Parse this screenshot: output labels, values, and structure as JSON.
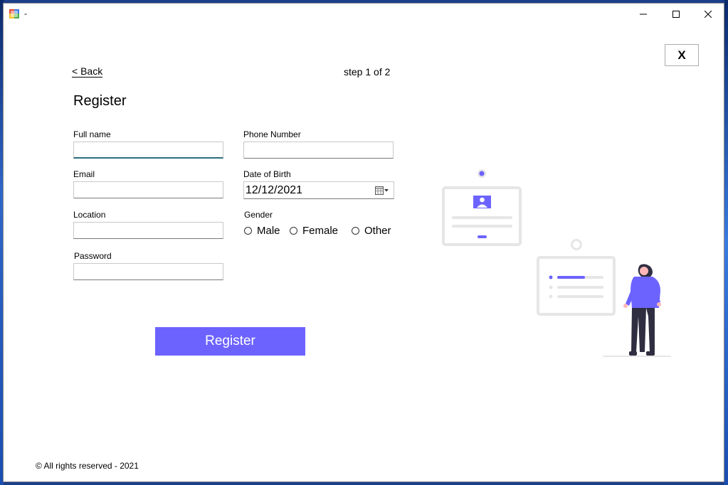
{
  "window": {
    "title": "-"
  },
  "form": {
    "back_label": "< Back",
    "step_label": "step 1 of 2",
    "title": "Register",
    "close_label": "X",
    "full_name": {
      "label": "Full name",
      "value": ""
    },
    "email": {
      "label": "Email",
      "value": ""
    },
    "location": {
      "label": "Location",
      "value": ""
    },
    "password": {
      "label": "Password",
      "value": ""
    },
    "phone": {
      "label": "Phone Number",
      "value": ""
    },
    "dob": {
      "label": "Date of Birth",
      "value": "12/12/2021"
    },
    "gender": {
      "label": "Gender",
      "options": [
        "Male",
        "Female",
        "Other"
      ],
      "selected": null
    },
    "submit_label": "Register"
  },
  "footer": {
    "text": "© All rights reserved - 2021"
  },
  "colors": {
    "accent": "#6c63ff",
    "focus_underline": "#2a6f7a",
    "illustration_gray": "#e6e6e6"
  },
  "icons": [
    "app-icon",
    "minimize-icon",
    "maximize-icon",
    "close-icon",
    "calendar-icon",
    "dropdown-arrow-icon"
  ]
}
